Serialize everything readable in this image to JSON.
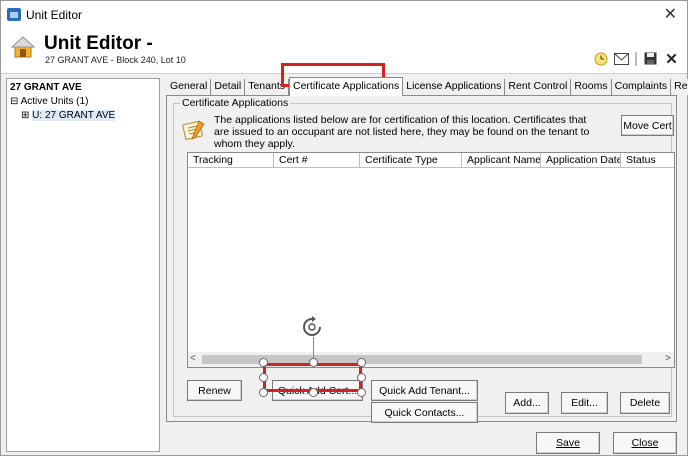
{
  "window": {
    "title": "Unit Editor",
    "close_glyph": "✕"
  },
  "header": {
    "title": "Unit Editor -",
    "subtitle": "27 GRANT AVE - Block 240, Lot 10",
    "icons": [
      "clock-icon",
      "mail-icon",
      "save-icon",
      "close-icon"
    ]
  },
  "tree": {
    "root": "27 GRANT AVE",
    "level1": "⊟ Active Units (1)",
    "level2_prefix": "⊞ ",
    "level2": "U: 27 GRANT AVE"
  },
  "tabs": [
    {
      "label": "General"
    },
    {
      "label": "Detail"
    },
    {
      "label": "Tenants"
    },
    {
      "label": "Certificate Applications"
    },
    {
      "label": "License Applications"
    },
    {
      "label": "Rent Control"
    },
    {
      "label": "Rooms"
    },
    {
      "label": "Complaints"
    },
    {
      "label": "Related"
    }
  ],
  "active_tab": "Certificate Applications",
  "panel": {
    "group_title": "Certificate Applications",
    "info_text": "The applications listed below are for certification of this location. Certificates that are issued to an occupant are not listed here, they may be found on the tenant to whom they apply.",
    "move_cert_label": "Move Cert",
    "columns": [
      "Tracking",
      "Cert #",
      "Certificate Type",
      "Applicant Name",
      "Application Date",
      "Status"
    ],
    "rows": []
  },
  "buttons": {
    "renew": "Renew",
    "quick_add_cert": "Quick Add Cert...",
    "quick_add_tenant": "Quick Add Tenant...",
    "quick_contacts": "Quick Contacts...",
    "add": "Add...",
    "edit": "Edit...",
    "delete": "Delete",
    "save": "Save",
    "close": "Close"
  },
  "colors": {
    "highlight": "#d4231e",
    "title_icon": "#2b6cb8"
  }
}
